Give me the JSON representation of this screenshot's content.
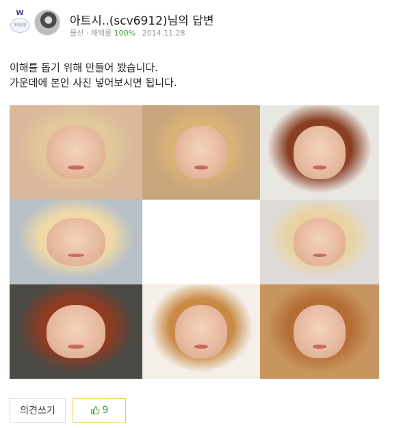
{
  "author": {
    "level_badge_letter": "W",
    "level_badge_text": "대리운영",
    "display_line": "아트시..(scv6912)님의 답변",
    "rank": "물신",
    "adopt_label": "채택률",
    "adopt_rate": "100%",
    "date": "2014.11.28"
  },
  "answer": {
    "line1": "이해를 돕기 위해 만들어 봤습니다.",
    "line2": "가운데에 본인 사진 넣어보시면 됩니다."
  },
  "photo_grid": {
    "rows": 3,
    "cols": 3,
    "center_empty": true,
    "tiles": [
      {
        "name": "photo-1",
        "bg": "#d9b99b",
        "hair": "#e2c89a"
      },
      {
        "name": "photo-2",
        "bg": "#c9a57c",
        "hair": "#d9b277"
      },
      {
        "name": "photo-3",
        "bg": "#e9e7e1",
        "hair": "#8a3e24"
      },
      {
        "name": "photo-4",
        "bg": "#b9c1c8",
        "hair": "#f0d9a6"
      },
      {
        "name": "photo-center-empty",
        "bg": "#ffffff",
        "hair": ""
      },
      {
        "name": "photo-6",
        "bg": "#dedbd8",
        "hair": "#e9d3a0"
      },
      {
        "name": "photo-7",
        "bg": "#4b4a44",
        "hair": "#8e3b22"
      },
      {
        "name": "photo-8",
        "bg": "#f4efe9",
        "hair": "#c98a45"
      },
      {
        "name": "photo-9",
        "bg": "#c7955f",
        "hair": "#b46e34"
      }
    ]
  },
  "actions": {
    "opinion_label": "의견쓰기",
    "like_count": "9",
    "like_color": "#3b9a3b",
    "like_border": "#f0c840"
  }
}
